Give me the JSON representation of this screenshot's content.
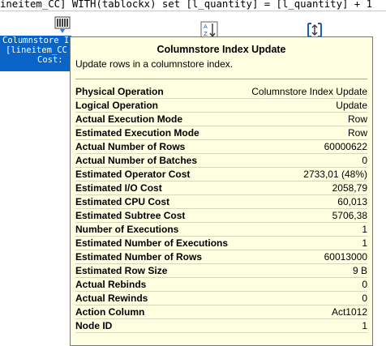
{
  "query": {
    "text": "ineitem_CC] WITH(tablockx) set [l_quantity] = [l_quantity] + 1"
  },
  "plan": {
    "operator_icons": [
      {
        "name": "columnstore-index-update-icon"
      },
      {
        "name": "sort-icon"
      },
      {
        "name": "compute-scalar-icon"
      }
    ],
    "node": {
      "line1": "Columnstore I",
      "line2": "[lineitem_CC",
      "line3": "Cost:"
    }
  },
  "tooltip": {
    "title": "Columnstore Index Update",
    "description": "Update rows in a columnstore index.",
    "rows": [
      {
        "label": "Physical Operation",
        "value": "Columnstore Index Update"
      },
      {
        "label": "Logical Operation",
        "value": "Update"
      },
      {
        "label": "Actual Execution Mode",
        "value": "Row"
      },
      {
        "label": "Estimated Execution Mode",
        "value": "Row"
      },
      {
        "label": "Actual Number of Rows",
        "value": "60000622"
      },
      {
        "label": "Actual Number of Batches",
        "value": "0"
      },
      {
        "label": "Estimated Operator Cost",
        "value": "2733,01 (48%)"
      },
      {
        "label": "Estimated I/O Cost",
        "value": "2058,79"
      },
      {
        "label": "Estimated CPU Cost",
        "value": "60,013"
      },
      {
        "label": "Estimated Subtree Cost",
        "value": "5706,38"
      },
      {
        "label": "Number of Executions",
        "value": "1"
      },
      {
        "label": "Estimated Number of Executions",
        "value": "1"
      },
      {
        "label": "Estimated Number of Rows",
        "value": "60013000"
      },
      {
        "label": "Estimated Row Size",
        "value": "9 B"
      },
      {
        "label": "Actual Rebinds",
        "value": "0"
      },
      {
        "label": "Actual Rewinds",
        "value": "0"
      },
      {
        "label": "Action Column",
        "value": "Act1012"
      },
      {
        "label": "Node ID",
        "value": "1"
      }
    ]
  },
  "colors": {
    "node_selected": "#0a64c8",
    "tooltip_background": "#ffffe1",
    "tooltip_border": "#767676"
  }
}
